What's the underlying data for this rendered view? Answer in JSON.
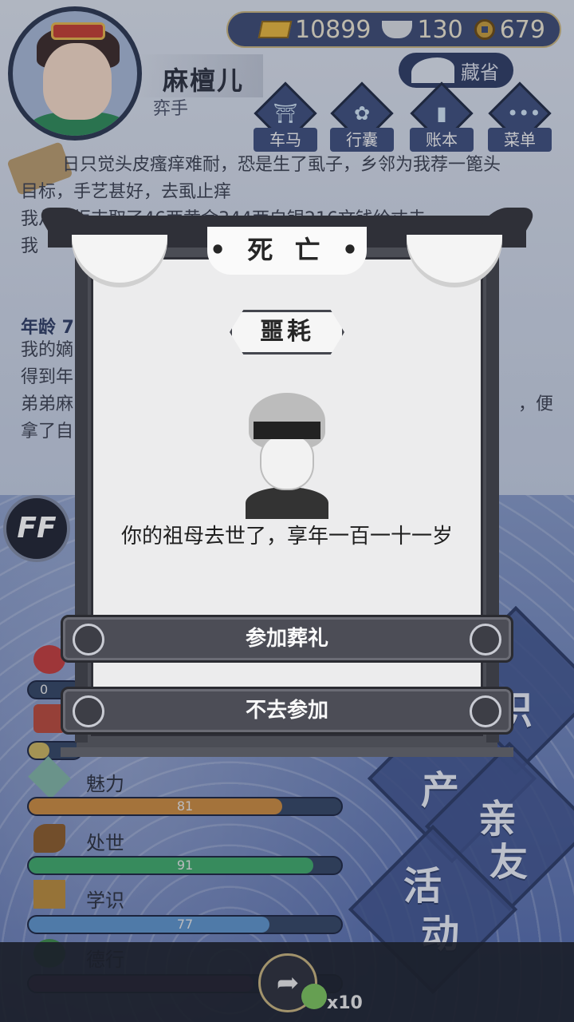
{
  "header": {
    "name": "麻檀儿",
    "job": "弈手",
    "currency": {
      "gold": "10899",
      "silver": "130",
      "coin": "679"
    },
    "cangsheng_label": "藏省",
    "menu": [
      {
        "label": "车马",
        "icon": "carriage-icon"
      },
      {
        "label": "行囊",
        "icon": "bag-icon"
      },
      {
        "label": "账本",
        "icon": "ledger-icon"
      },
      {
        "label": "菜单",
        "icon": "more-icon"
      }
    ]
  },
  "story": {
    "line1": "日只觉头皮瘙痒难耐，恐是生了虱子，乡邻为我荐一篦头",
    "line2": "目标，手艺甚好，去虱止痒",
    "line3": "我从钱柜支取了46两黄金344两白银216文钱给丈夫",
    "line4": "我",
    "age_label": "年龄 7",
    "line5": "我的嫡",
    "line6": "得到年",
    "line7": "弟弟麻",
    "line8": "拿了自",
    "tail": "，便"
  },
  "stats": {
    "charm_label": "魅力",
    "charm_value": "81",
    "conduct_label": "处世",
    "conduct_value": "91",
    "learning_label": "学识",
    "learning_value": "77",
    "virtue_label": "德行",
    "top_value": "0"
  },
  "side_tabs": {
    "knowledge": "识",
    "property": "产",
    "relatives_1": "亲",
    "relatives_2": "友",
    "activity_1": "活",
    "activity_2": "动"
  },
  "ff_label": "FF",
  "bottom": {
    "multiplier": "x10"
  },
  "dialog": {
    "title": "• 死 亡 •",
    "subtitle": "噩耗",
    "message": "你的祖母去世了，享年一百一十一岁",
    "btn_attend": "参加葬礼",
    "btn_skip": "不去参加"
  }
}
